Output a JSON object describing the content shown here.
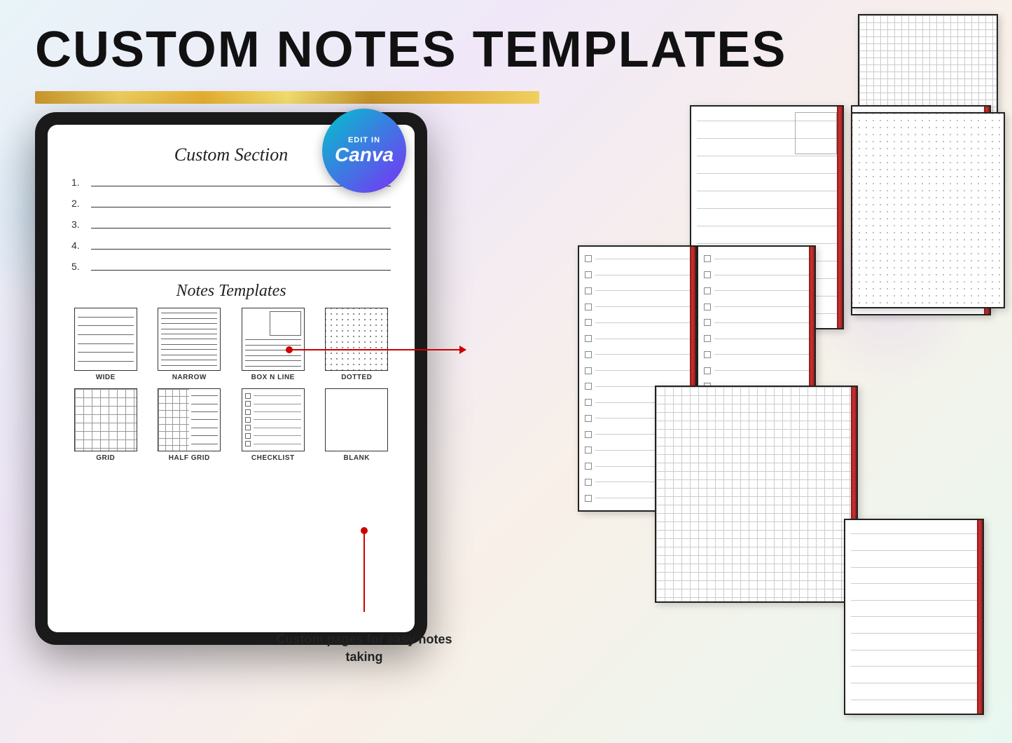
{
  "title": "CUSTOM NOTES TEMPLATES",
  "goldBar": true,
  "canvaBadge": {
    "editIn": "EDIT IN",
    "canva": "Canva"
  },
  "tablet": {
    "customSection": {
      "title": "Custom Section",
      "lines": [
        "1.",
        "2.",
        "3.",
        "4.",
        "5."
      ]
    },
    "notesTemplates": {
      "title": "Notes Templates",
      "items": [
        {
          "label": "WIDE",
          "type": "wide"
        },
        {
          "label": "NARROW",
          "type": "narrow"
        },
        {
          "label": "BOX N LINE",
          "type": "box-n-line"
        },
        {
          "label": "DOTTED",
          "type": "dotted"
        },
        {
          "label": "GRID",
          "type": "grid"
        },
        {
          "label": "HALF GRID",
          "type": "half-grid"
        },
        {
          "label": "CHECKLIST",
          "type": "checklist"
        },
        {
          "label": "BLANK",
          "type": "blank"
        }
      ]
    }
  },
  "caption": {
    "line1": "Custom pages for easy notes",
    "line2": "taking"
  },
  "icons": {
    "arrowRight": "→",
    "dot": "●"
  }
}
